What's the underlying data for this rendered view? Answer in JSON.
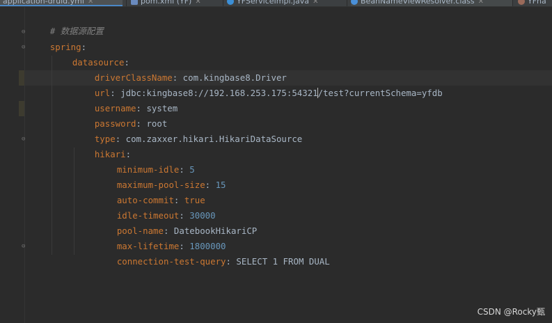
{
  "tabs": [
    {
      "label": "application-druid.yml",
      "icon": "yaml-file-icon",
      "active": true
    },
    {
      "label": "pom.xml (YF)",
      "icon": "maven-file-icon",
      "active": false
    },
    {
      "label": "YFServiceImpl.java",
      "icon": "java-class-icon",
      "active": false
    },
    {
      "label": "BeanNameViewResolver.class",
      "icon": "class-file-icon",
      "active": false
    },
    {
      "label": "YFha",
      "icon": "file-icon",
      "active": false
    }
  ],
  "editor": {
    "comment": "# 数据源配置",
    "spring_key": "spring",
    "datasource_key": "datasource",
    "driver_key": "driverClassName",
    "driver_value": "com.kingbase8.Driver",
    "url_key": "url",
    "url_value_before_cursor": "jdbc:kingbase8://192.168.253.175:54321",
    "url_value_after_cursor": "/test?currentSchema=yfdb",
    "username_key": "username",
    "username_value": "system",
    "password_key": "password",
    "password_value": "root",
    "type_key": "type",
    "type_value": "com.zaxxer.hikari.HikariDataSource",
    "hikari_key": "hikari",
    "min_idle_key": "minimum-idle",
    "min_idle_value": "5",
    "max_pool_key": "maximum-pool-size",
    "max_pool_value": "15",
    "auto_commit_key": "auto-commit",
    "auto_commit_value": "true",
    "idle_timeout_key": "idle-timeout",
    "idle_timeout_value": "30000",
    "pool_name_key": "pool-name",
    "pool_name_value": "DatebookHikariCP",
    "max_lifetime_key": "max-lifetime",
    "max_lifetime_value": "1800000",
    "test_query_key": "connection-test-query",
    "test_query_value": "SELECT 1 FROM DUAL"
  },
  "watermark": "CSDN @Rocky甄",
  "colors": {
    "background": "#2b2b2b",
    "key": "#cc7832",
    "number": "#6897bb",
    "comment": "#808080",
    "text": "#a9b7c6"
  }
}
